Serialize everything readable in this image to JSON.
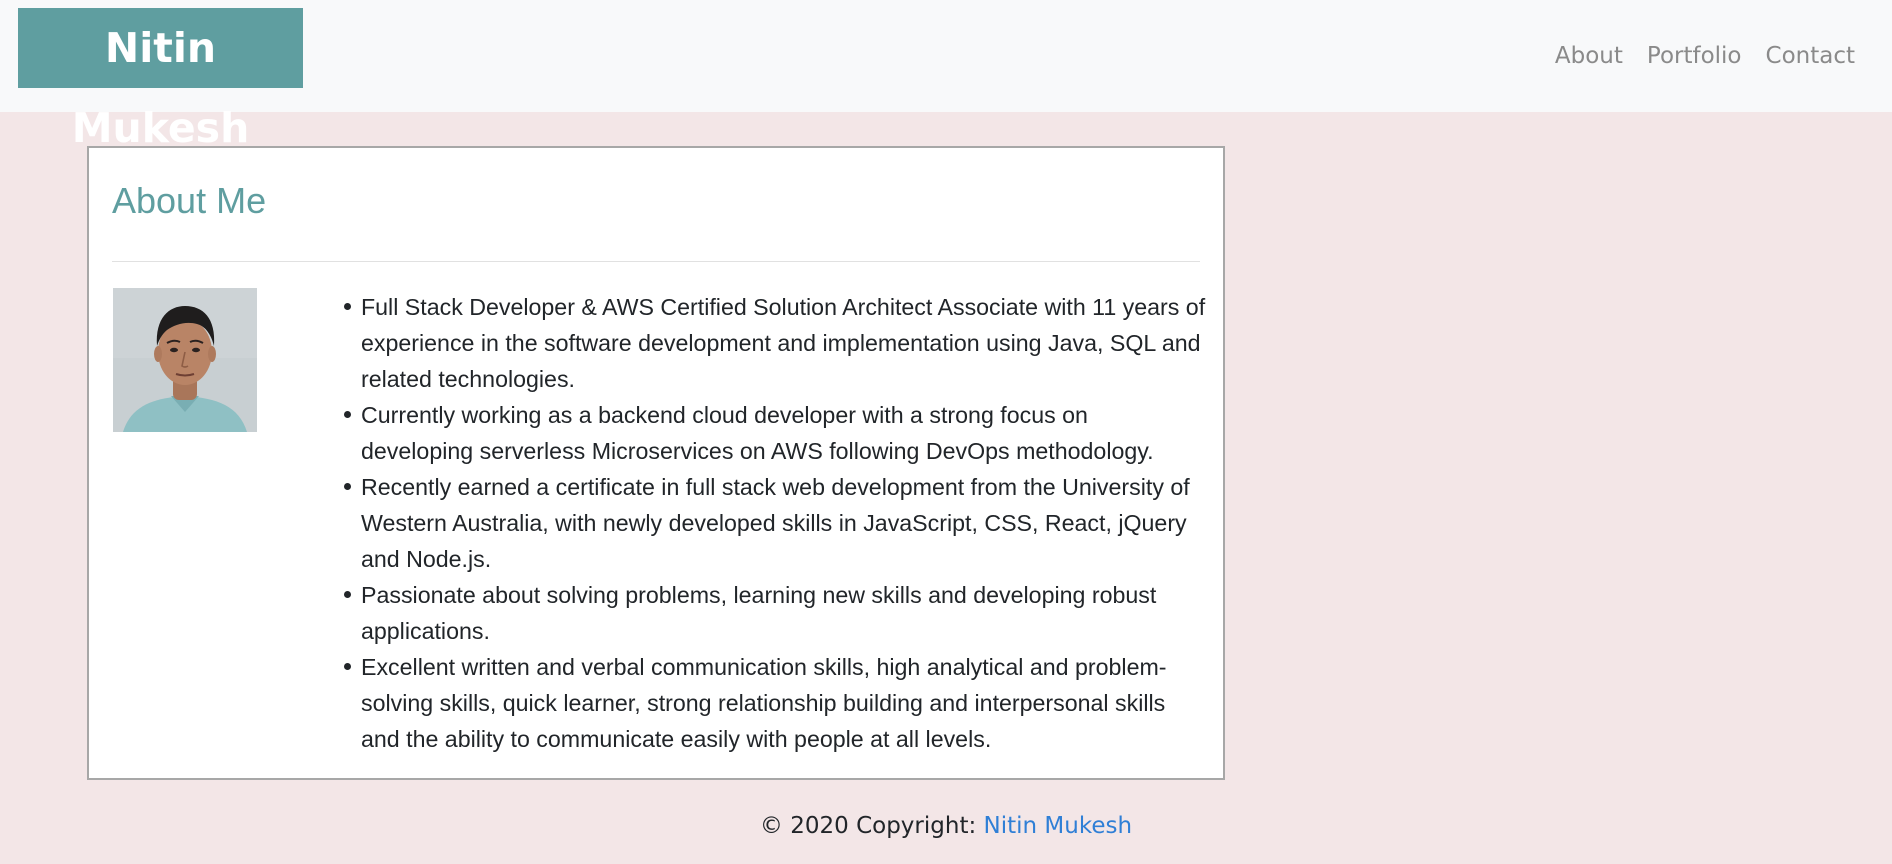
{
  "navbar": {
    "brand": "Nitin Mukesh",
    "links": [
      "About",
      "Portfolio",
      "Contact"
    ]
  },
  "about": {
    "title": "About Me",
    "photo_alt": "Nitin Mukesh profile photo",
    "bullets": [
      "Full Stack Developer & AWS Certified Solution Architect Associate with 11 years of experience in the software development and implementation using Java, SQL and related technologies.",
      "Currently working as a backend cloud developer with a strong focus on developing serverless Microservices on AWS following DevOps methodology.",
      "Recently earned a certificate in full stack web development from the University of Western Australia, with newly developed skills in JavaScript, CSS, React, jQuery and Node.js.",
      "Passionate about solving problems, learning new skills and developing robust applications.",
      "Excellent written and verbal communication skills, high analytical and problem-solving skills, quick learner, strong relationship building and interpersonal skills and the ability to communicate easily with people at all levels."
    ]
  },
  "footer": {
    "copyright": "© 2020 Copyright: ",
    "link_text": "Nitin Mukesh"
  },
  "colors": {
    "accent": "#5f9ea0",
    "page_background": "#f3e6e7",
    "navbar_background": "#f8f9fa",
    "footer_link": "#2f7fd6"
  }
}
